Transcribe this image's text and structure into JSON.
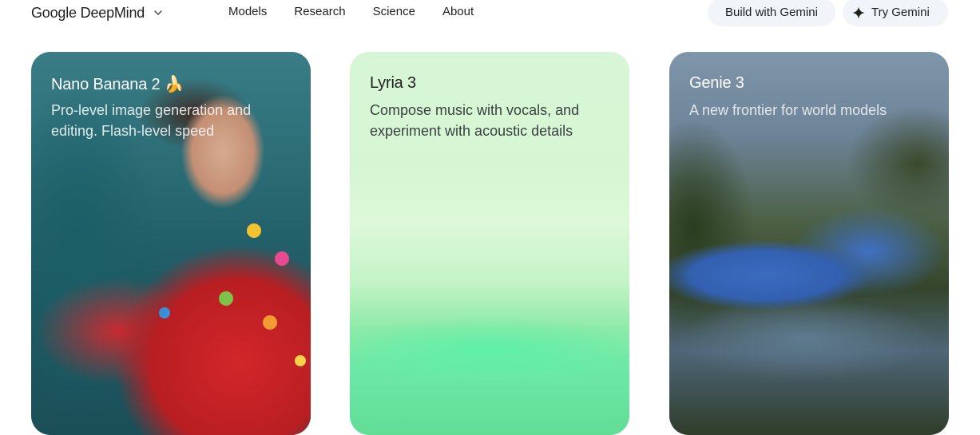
{
  "header": {
    "brand": "Google DeepMind",
    "brand_menu_icon": "chevron-down-icon",
    "nav": [
      "Models",
      "Research",
      "Science",
      "About"
    ],
    "build_label": "Build with Gemini",
    "try_label": "Try Gemini",
    "try_icon": "sparkle-icon"
  },
  "cards": [
    {
      "title": "Nano Banana 2 🍌",
      "description": "Pro-level image generation and editing. Flash-level speed",
      "text_color": "#ffffff"
    },
    {
      "title": "Lyria 3",
      "description": "Compose music with vocals, and experiment with acoustic details",
      "text_color": "#1f1f1f"
    },
    {
      "title": "Genie 3",
      "description": "A new frontier for world models",
      "text_color": "#ffffff"
    }
  ],
  "colors": {
    "pill_background": "#f1f4f9",
    "card2_background": "#d7f6d6"
  }
}
